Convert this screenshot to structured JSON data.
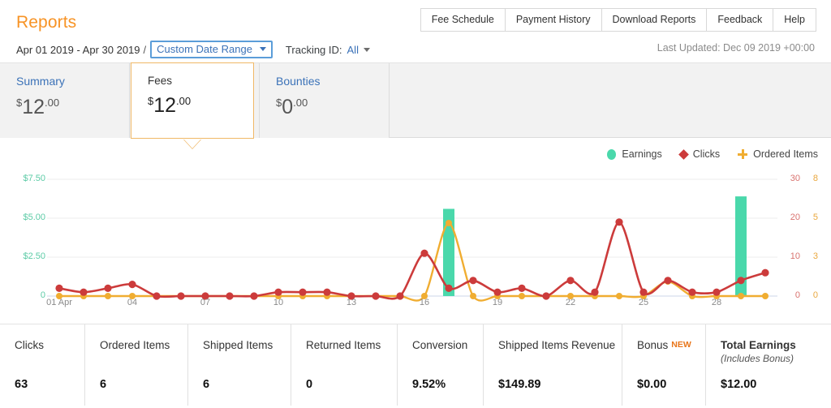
{
  "header": {
    "title": "Reports",
    "date_range": "Apr 01 2019 - Apr 30 2019",
    "separator": "/",
    "date_mode": "Custom Date Range",
    "tracking_label": "Tracking ID:",
    "tracking_value": "All",
    "last_updated": "Last Updated: Dec 09 2019 +00:00",
    "nav_buttons": [
      "Fee Schedule",
      "Payment History",
      "Download Reports",
      "Feedback",
      "Help"
    ]
  },
  "summary_tabs": [
    {
      "label": "Summary",
      "currency": "$",
      "whole": "12",
      "cents": ".00"
    },
    {
      "label": "Fees",
      "currency": "$",
      "whole": "12",
      "cents": ".00"
    },
    {
      "label": "Bounties",
      "currency": "$",
      "whole": "0",
      "cents": ".00"
    }
  ],
  "chart_data": {
    "type": "line",
    "title": "",
    "xlabel": "",
    "legend": [
      {
        "name": "Earnings",
        "color": "#4ad8ab",
        "marker": "circle"
      },
      {
        "name": "Clicks",
        "color": "#cc3b3b",
        "marker": "diamond"
      },
      {
        "name": "Ordered Items",
        "color": "#f0ad31",
        "marker": "plus"
      }
    ],
    "legend_position": "top-right",
    "grid": true,
    "axes": {
      "left": {
        "name": "Earnings",
        "ticks": [
          "0",
          "$2.50",
          "$5.00",
          "$7.50"
        ],
        "values": [
          0,
          2.5,
          5,
          7.5
        ],
        "ylim": [
          0,
          7.5
        ],
        "color": "#5ccba6"
      },
      "right1": {
        "name": "Clicks",
        "ticks": [
          "0",
          "10",
          "20",
          "30"
        ],
        "values": [
          0,
          10,
          20,
          30
        ],
        "ylim": [
          0,
          30
        ],
        "color": "#d9736f"
      },
      "right2": {
        "name": "Ordered Items",
        "ticks": [
          "0",
          "3",
          "5",
          "8"
        ],
        "values": [
          0,
          2.5,
          5,
          8
        ],
        "ylim": [
          0,
          8
        ],
        "color": "#eaa83f"
      }
    },
    "x_ticks": [
      "01 Apr",
      "04",
      "07",
      "10",
      "13",
      "16",
      "19",
      "22",
      "25",
      "28"
    ],
    "x_tick_days": [
      1,
      4,
      7,
      10,
      13,
      16,
      19,
      22,
      25,
      28
    ],
    "days": [
      1,
      2,
      3,
      4,
      5,
      6,
      7,
      8,
      9,
      10,
      11,
      12,
      13,
      14,
      15,
      16,
      17,
      18,
      19,
      20,
      21,
      22,
      23,
      24,
      25,
      26,
      27,
      28,
      29,
      30
    ],
    "series": [
      {
        "name": "Earnings",
        "axis": "left",
        "type": "bar",
        "values": [
          0,
          0,
          0,
          0,
          0,
          0,
          0,
          0,
          0,
          0,
          0,
          0,
          0,
          0,
          0,
          0,
          5.6,
          0,
          0,
          0,
          0,
          0,
          0,
          0,
          0,
          0,
          0,
          0,
          6.4,
          0
        ]
      },
      {
        "name": "Clicks",
        "axis": "right1",
        "type": "line",
        "values": [
          2,
          1,
          2,
          3,
          0,
          0,
          0,
          0,
          0,
          1,
          1,
          1,
          0,
          0,
          0,
          11,
          2,
          4,
          1,
          2,
          0,
          4,
          1,
          19,
          1,
          4,
          1,
          1,
          4,
          6
        ]
      },
      {
        "name": "Ordered Items",
        "axis": "right2",
        "type": "line",
        "values": [
          0,
          0,
          0,
          0,
          0,
          0,
          0,
          0,
          0,
          0,
          0,
          0,
          0,
          0,
          0,
          0,
          5,
          0,
          0,
          0,
          0,
          0,
          0,
          0,
          0,
          1,
          0,
          0,
          0,
          0
        ]
      }
    ]
  },
  "stats": {
    "columns": [
      {
        "label": "Clicks",
        "value": "63",
        "badge": "",
        "sub": "",
        "bold": false
      },
      {
        "label": "Ordered Items",
        "value": "6",
        "badge": "",
        "sub": "",
        "bold": false
      },
      {
        "label": "Shipped Items",
        "value": "6",
        "badge": "",
        "sub": "",
        "bold": false
      },
      {
        "label": "Returned Items",
        "value": "0",
        "badge": "",
        "sub": "",
        "bold": false
      },
      {
        "label": "Conversion",
        "value": "9.52%",
        "badge": "",
        "sub": "",
        "bold": false
      },
      {
        "label": "Shipped Items Revenue",
        "value": "$149.89",
        "badge": "",
        "sub": "",
        "bold": false
      },
      {
        "label": "Bonus",
        "value": "$0.00",
        "badge": "NEW",
        "sub": "",
        "bold": false
      },
      {
        "label": "Total Earnings",
        "value": "$12.00",
        "badge": "",
        "sub": "(Includes Bonus)",
        "bold": true
      }
    ],
    "widths": [
      105,
      127,
      127,
      131,
      106,
      171,
      103,
      154
    ]
  }
}
